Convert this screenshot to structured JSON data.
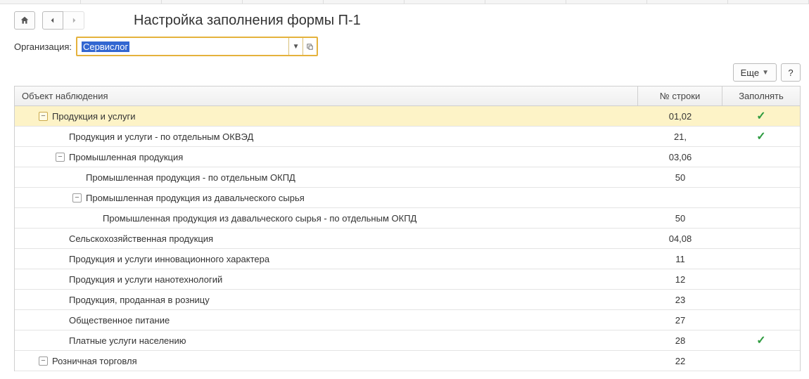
{
  "page_title": "Настройка заполнения формы П-1",
  "org_label": "Организация:",
  "org_value": "Сервислог",
  "more_label": "Еще",
  "help_label": "?",
  "columns": {
    "object": "Объект наблюдения",
    "line": "№ строки",
    "fill": "Заполнять"
  },
  "rows": [
    {
      "level": 0,
      "selected": true,
      "expander": "minus",
      "label": "Продукция и услуги",
      "line": "01,02",
      "fill": true
    },
    {
      "level": 1,
      "expander": "none",
      "label": "Продукция и услуги - по отдельным ОКВЭД",
      "line": "21,",
      "fill": true
    },
    {
      "level": 1,
      "expander": "minus",
      "label": "Промышленная продукция",
      "line": "03,06",
      "fill": false
    },
    {
      "level": 2,
      "expander": "none",
      "label": "Промышленная продукция - по отдельным ОКПД",
      "line": "50",
      "fill": false
    },
    {
      "level": 2,
      "expander": "minus",
      "label": "Промышленная продукция из давальческого сырья",
      "line": "",
      "fill": false
    },
    {
      "level": 3,
      "expander": "none",
      "label": "Промышленная продукция из давальческого сырья - по отдельным ОКПД",
      "line": "50",
      "fill": false
    },
    {
      "level": 1,
      "expander": "none",
      "label": "Сельскохозяйственная продукция",
      "line": "04,08",
      "fill": false
    },
    {
      "level": 1,
      "expander": "none",
      "label": "Продукция и услуги инновационного характера",
      "line": "11",
      "fill": false
    },
    {
      "level": 1,
      "expander": "none",
      "label": "Продукция и услуги нанотехнологий",
      "line": "12",
      "fill": false
    },
    {
      "level": 1,
      "expander": "none",
      "label": "Продукция, проданная в розницу",
      "line": "23",
      "fill": false
    },
    {
      "level": 1,
      "expander": "none",
      "label": "Общественное питание",
      "line": "27",
      "fill": false
    },
    {
      "level": 1,
      "expander": "none",
      "label": "Платные услуги населению",
      "line": "28",
      "fill": true
    },
    {
      "level": 0,
      "expander": "minus",
      "label": "Розничная торговля",
      "line": "22",
      "fill": false
    }
  ]
}
